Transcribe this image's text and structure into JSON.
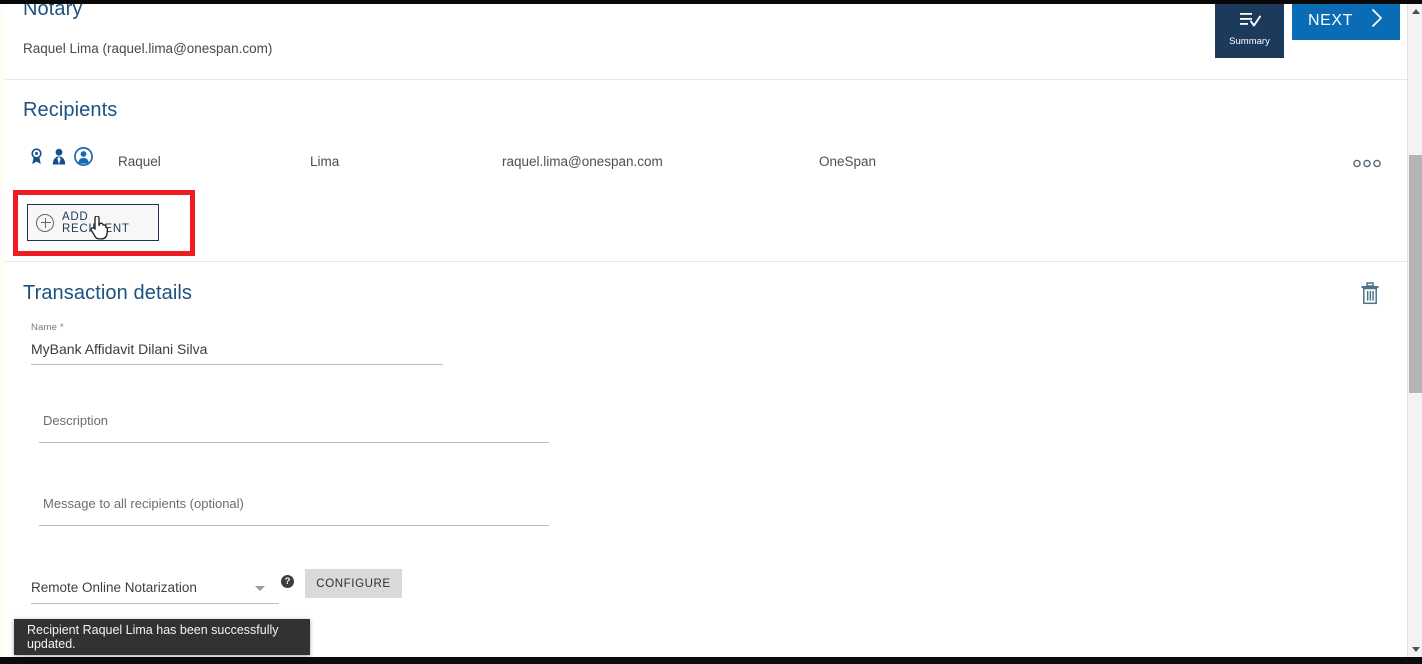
{
  "window": {
    "background": "#ffffff",
    "accent_blue": "#1c5180",
    "next_blue": "#0a6cb5",
    "summary_navy": "#1b3a5c",
    "highlight_red": "#ee1c22",
    "toast_bg": "#323232"
  },
  "notary": {
    "title": "Notary",
    "person": "Raquel Lima (raquel.lima@onespan.com)"
  },
  "recipients": {
    "title": "Recipients",
    "icons": [
      "notary-seal-icon",
      "signer-person-icon",
      "avatar-circle-icon"
    ],
    "rows": [
      {
        "first_name": "Raquel",
        "last_name": "Lima",
        "email": "raquel.lima@onespan.com",
        "organization": "OneSpan",
        "menu": "● ● ●"
      }
    ],
    "add_button_label": "ADD RECIPIENT"
  },
  "transaction": {
    "title": "Transaction details",
    "name_label": "Name *",
    "name_value": "MyBank Affidavit Dilani Silva",
    "description_placeholder": "Description",
    "description_value": "",
    "message_placeholder": "Message to all recipients (optional)",
    "message_value": "",
    "notarization_type": "Remote Online Notarization",
    "help_glyph": "?",
    "configure_label": "CONFIGURE"
  },
  "toolbar": {
    "summary_label": "Summary",
    "next_label": "NEXT"
  },
  "toast": {
    "message": "Recipient Raquel Lima has been successfully updated."
  },
  "scrollbar": {
    "up_arrow": "▲",
    "down_arrow": "▼"
  }
}
